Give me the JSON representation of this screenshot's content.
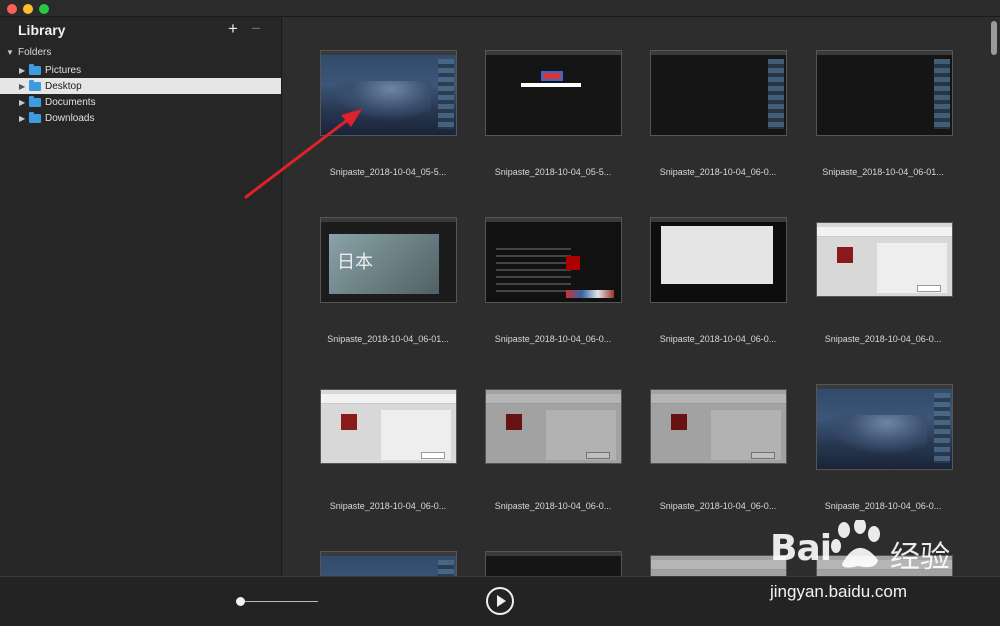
{
  "sidebar": {
    "title": "Library",
    "add_icon": "+",
    "remove_icon": "−",
    "root": "Folders",
    "items": [
      {
        "label": "Pictures",
        "selected": false
      },
      {
        "label": "Desktop",
        "selected": true
      },
      {
        "label": "Documents",
        "selected": false
      },
      {
        "label": "Downloads",
        "selected": false
      }
    ]
  },
  "grid": {
    "captions": [
      "Snipaste_2018-10-04_05-5...",
      "Snipaste_2018-10-04_05-5...",
      "Snipaste_2018-10-04_06-0...",
      "Snipaste_2018-10-04_06-01...",
      "Snipaste_2018-10-04_06-01...",
      "Snipaste_2018-10-04_06-0...",
      "Snipaste_2018-10-04_06-0...",
      "Snipaste_2018-10-04_06-0...",
      "Snipaste_2018-10-04_06-0...",
      "Snipaste_2018-10-04_06-0...",
      "Snipaste_2018-10-04_06-0...",
      "Snipaste_2018-10-04_06-0..."
    ]
  },
  "watermark": {
    "brand": "Bai",
    "brand_cn": "经验",
    "url": "jingyan.baidu.com"
  },
  "icons": {
    "window_controls": [
      "close-icon",
      "minimize-icon",
      "zoom-icon"
    ],
    "folder": "folder-icon",
    "play": "play-icon",
    "annotation": "red-arrow-annotation"
  },
  "colors": {
    "accent_folder": "#3f9be0",
    "annotation_arrow": "#e0202a"
  }
}
